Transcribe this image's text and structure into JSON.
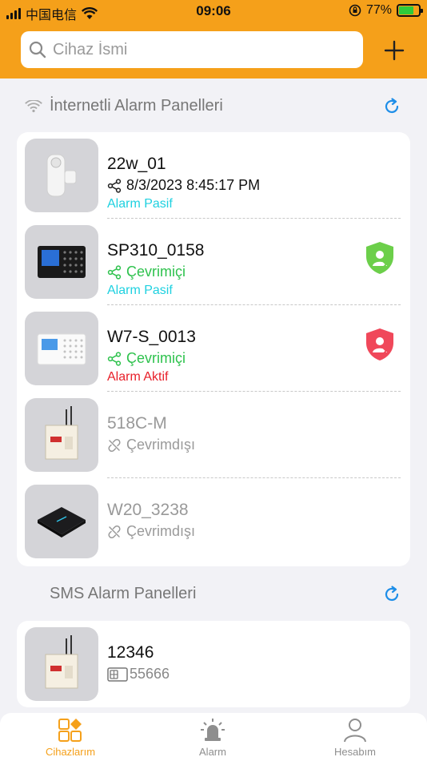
{
  "status_bar": {
    "carrier": "中国电信",
    "time": "09:06",
    "battery": "77%",
    "battery_level": 0.77
  },
  "search": {
    "placeholder": "Cihaz İsmi"
  },
  "internet_section": {
    "title": "İnternetli Alarm Panelleri",
    "devices": [
      {
        "name": "22w_01",
        "status": "8/3/2023 8:45:17 PM",
        "status_icon": "share-icon",
        "alarm": "Alarm Pasif",
        "online": true,
        "badge": null
      },
      {
        "name": "SP310_0158",
        "status": "Çevrimiçi",
        "status_icon": "share-icon",
        "alarm": "Alarm Pasif",
        "online": true,
        "badge": "green-shield-icon"
      },
      {
        "name": "W7-S_0013",
        "status": "Çevrimiçi",
        "status_icon": "share-icon",
        "alarm": "Alarm Aktif",
        "online": true,
        "badge": "red-shield-icon"
      },
      {
        "name": "518C-M",
        "status": "Çevrimdışı",
        "status_icon": "broken-link-icon",
        "alarm": "",
        "online": false,
        "badge": null
      },
      {
        "name": "W20_3238",
        "status": "Çevrimdışı",
        "status_icon": "broken-link-icon",
        "alarm": "",
        "online": false,
        "badge": null
      }
    ]
  },
  "sms_section": {
    "title": "SMS Alarm Panelleri",
    "devices": [
      {
        "name": "12346",
        "number": "55666",
        "status_icon": "sim-card-icon"
      }
    ]
  },
  "tabs": [
    {
      "label": "Cihazlarım",
      "icon": "devices-icon",
      "active": true
    },
    {
      "label": "Alarm",
      "icon": "siren-icon",
      "active": false
    },
    {
      "label": "Hesabım",
      "icon": "person-icon",
      "active": false
    }
  ],
  "colors": {
    "header": "#f5a01a",
    "online": "#2ec24d",
    "alarm_passive": "#1fd1e0",
    "alarm_active": "#e8202a",
    "refresh": "#1e8ee8"
  }
}
